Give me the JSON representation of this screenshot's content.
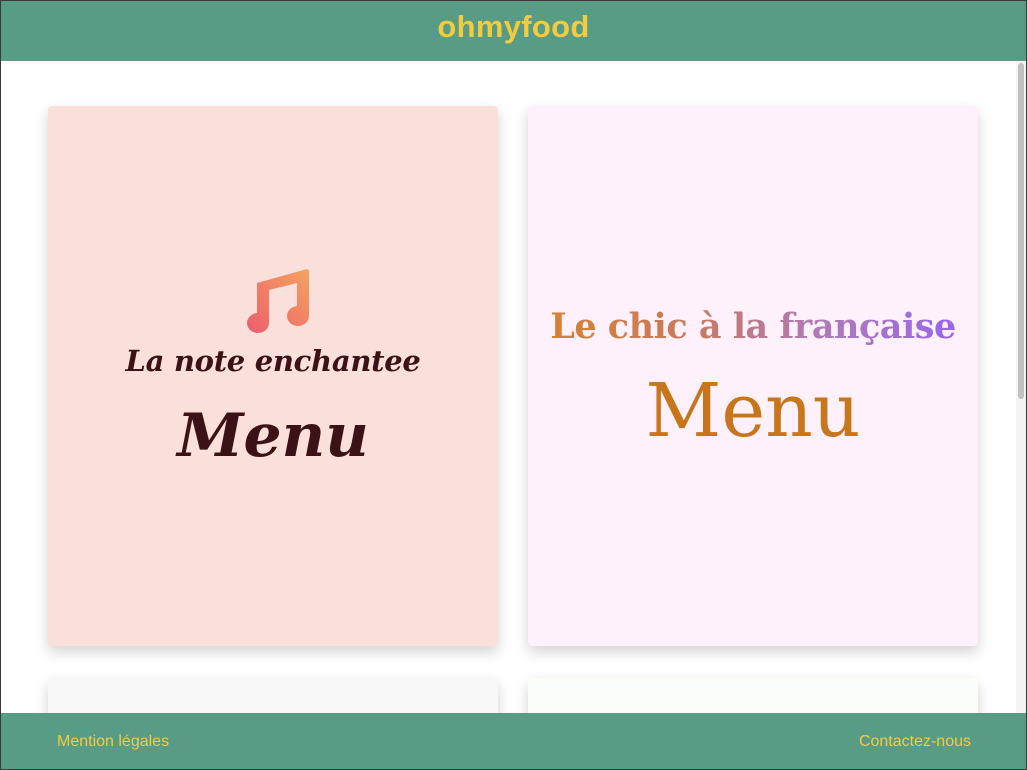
{
  "header": {
    "logo": "ohmyfood"
  },
  "cards": [
    {
      "name": "La note enchantee",
      "menu_label": "Menu",
      "icon": "music-note-icon",
      "background": "#fbdfdb",
      "text_color": "#3b1216"
    },
    {
      "name": "Le chic à la française",
      "menu_label": "Menu",
      "background": "#fef1fb",
      "title_gradient": [
        "#d8832d",
        "#9463f4"
      ],
      "menu_color": "#c8761c"
    }
  ],
  "footer": {
    "left_link": "Mention légales",
    "right_link": "Contactez-nous"
  },
  "colors": {
    "brand_green": "#589c86",
    "brand_yellow": "#f4cb3e"
  }
}
